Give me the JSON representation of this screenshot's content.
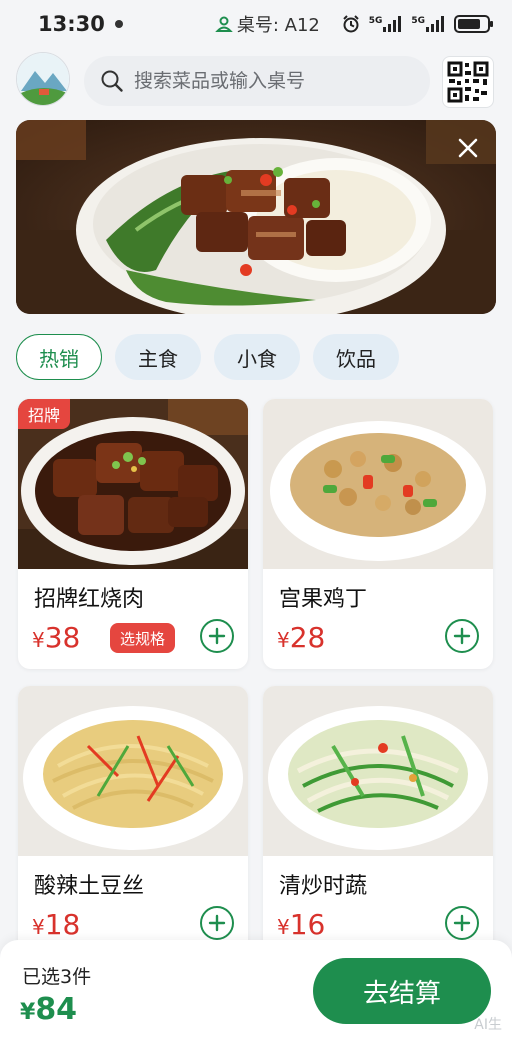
{
  "status_bar": {
    "time": "13:30",
    "table_label": "桌号: A12",
    "signal_1": "5G",
    "signal_2": "5G"
  },
  "header": {
    "search_placeholder": "搜索菜品或输入桌号"
  },
  "banner": {
    "dish_icon": "braised-pork-rice-photo"
  },
  "tabs": [
    {
      "label": "热销",
      "active": true
    },
    {
      "label": "主食",
      "active": false
    },
    {
      "label": "小食",
      "active": false
    },
    {
      "label": "饮品",
      "active": false
    }
  ],
  "menu": {
    "items": [
      {
        "name": "招牌红烧肉",
        "currency": "¥",
        "price": "38",
        "tag": "招牌",
        "spec_button": "选规格"
      },
      {
        "name": "宫果鸡丁",
        "currency": "¥",
        "price": "28"
      },
      {
        "name": "酸辣土豆丝",
        "currency": "¥",
        "price": "18"
      },
      {
        "name": "清炒时蔬",
        "currency": "¥",
        "price": "16"
      }
    ]
  },
  "cart": {
    "selected_text": "已选3件",
    "currency": "¥",
    "total": "84",
    "checkout_label": "去结算"
  },
  "watermark": "AI生",
  "colors": {
    "brand_green": "#1e8e4e",
    "price_red": "#d8322c",
    "tag_red": "#e5463f"
  }
}
